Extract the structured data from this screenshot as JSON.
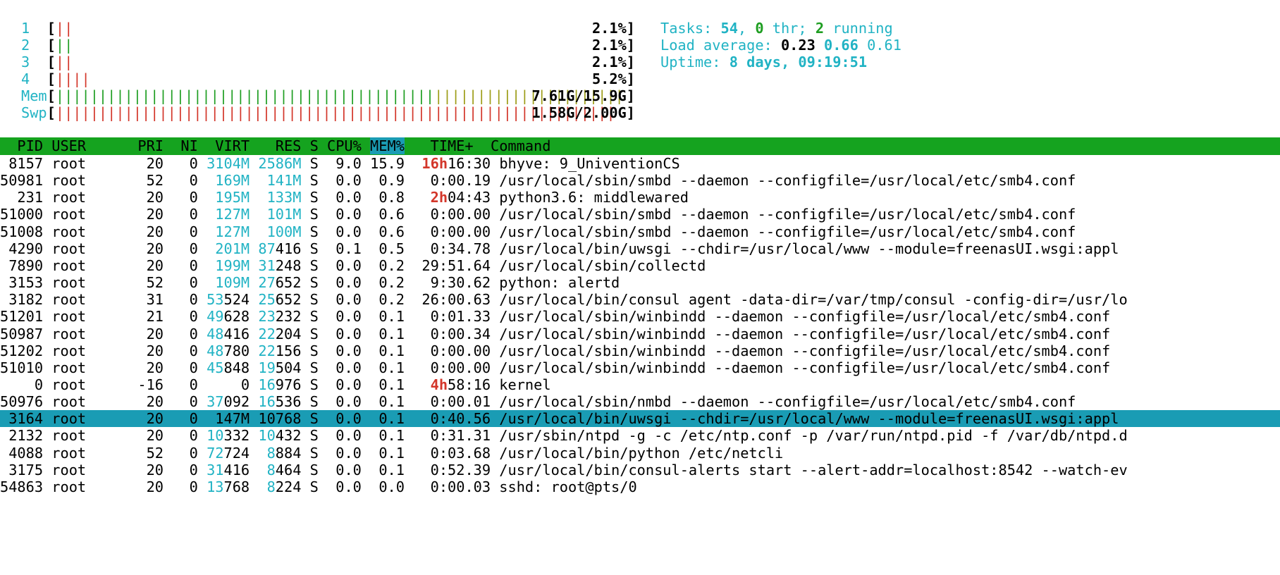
{
  "cpus": [
    {
      "label": "1",
      "bar_red": "||",
      "bar_green": "",
      "percent": "2.1%"
    },
    {
      "label": "2",
      "bar_red": "",
      "bar_green": "||",
      "percent": "2.1%"
    },
    {
      "label": "3",
      "bar_red": "||",
      "bar_green": "",
      "percent": "2.1%"
    },
    {
      "label": "4",
      "bar_red": "||||",
      "bar_green": "",
      "percent": "5.2%"
    }
  ],
  "mem": {
    "label": "Mem",
    "bar_green": "||||||||||||||||||||||||||||||||||||||||||||",
    "bar_olive": "||||||||||||||||||||||",
    "value": "7.61G/15.9G"
  },
  "swp": {
    "label": "Swp",
    "bar_red": "|||||||||||||||||||||||||||||||||||||||||||||||||||||||||||||||||",
    "value": "1.58G/2.00G"
  },
  "tasks": {
    "label": "Tasks: ",
    "count": "54",
    "sep1": ", ",
    "thr": "0",
    "thr_label": " thr; ",
    "running": "2",
    "running_label": " running"
  },
  "load": {
    "label": "Load average: ",
    "v1": "0.23",
    "v2": "0.66",
    "v3": "0.61"
  },
  "uptime": {
    "label": "Uptime: ",
    "value": "8 days, 09:19:51"
  },
  "header": {
    "left": "  PID USER      PRI  NI  VIRT   RES S CPU% ",
    "sort": "MEM%",
    "right": "   TIME+  Command"
  },
  "selected_pid": "3164",
  "processes": [
    {
      "pid": "8157",
      "user": "root",
      "pri": "20",
      "ni": "0",
      "virt": "3104M",
      "res": "2586M",
      "s": "S",
      "cpu": "9.0",
      "mem": "15.9",
      "time_hi": "16h",
      "time_lo": "16:30",
      "cmd": "bhyve: 9_UniventionCS"
    },
    {
      "pid": "50981",
      "user": "root",
      "pri": "52",
      "ni": "0",
      "virt": "169M",
      "res": "141M",
      "s": "S",
      "cpu": "0.0",
      "mem": "0.9",
      "time_hi": "",
      "time_lo": "0:00.19",
      "cmd": "/usr/local/sbin/smbd --daemon --configfile=/usr/local/etc/smb4.conf"
    },
    {
      "pid": "231",
      "user": "root",
      "pri": "20",
      "ni": "0",
      "virt": "195M",
      "res": "133M",
      "s": "S",
      "cpu": "0.0",
      "mem": "0.8",
      "time_hi": "2h",
      "time_lo": "04:43",
      "cmd": "python3.6: middlewared"
    },
    {
      "pid": "51000",
      "user": "root",
      "pri": "20",
      "ni": "0",
      "virt": "127M",
      "res": "101M",
      "s": "S",
      "cpu": "0.0",
      "mem": "0.6",
      "time_hi": "",
      "time_lo": "0:00.00",
      "cmd": "/usr/local/sbin/smbd --daemon --configfile=/usr/local/etc/smb4.conf"
    },
    {
      "pid": "51008",
      "user": "root",
      "pri": "20",
      "ni": "0",
      "virt": "127M",
      "res": "100M",
      "s": "S",
      "cpu": "0.0",
      "mem": "0.6",
      "time_hi": "",
      "time_lo": "0:00.00",
      "cmd": "/usr/local/sbin/smbd --daemon --configfile=/usr/local/etc/smb4.conf"
    },
    {
      "pid": "4290",
      "user": "root",
      "pri": "20",
      "ni": "0",
      "virt": "201M",
      "res": "87416",
      "s": "S",
      "cpu": "0.1",
      "mem": "0.5",
      "time_hi": "",
      "time_lo": "0:34.78",
      "cmd": "/usr/local/bin/uwsgi --chdir=/usr/local/www --module=freenasUI.wsgi:appl"
    },
    {
      "pid": "7890",
      "user": "root",
      "pri": "20",
      "ni": "0",
      "virt": "199M",
      "res": "31248",
      "s": "S",
      "cpu": "0.0",
      "mem": "0.2",
      "time_hi": "",
      "time_lo": "29:51.64",
      "cmd": "/usr/local/sbin/collectd"
    },
    {
      "pid": "3153",
      "user": "root",
      "pri": "52",
      "ni": "0",
      "virt": "109M",
      "res": "27652",
      "s": "S",
      "cpu": "0.0",
      "mem": "0.2",
      "time_hi": "",
      "time_lo": "9:30.62",
      "cmd": "python: alertd"
    },
    {
      "pid": "3182",
      "user": "root",
      "pri": "31",
      "ni": "0",
      "virt": "53524",
      "res": "25652",
      "s": "S",
      "cpu": "0.0",
      "mem": "0.2",
      "time_hi": "",
      "time_lo": "26:00.63",
      "cmd": "/usr/local/bin/consul agent -data-dir=/var/tmp/consul -config-dir=/usr/lo"
    },
    {
      "pid": "51201",
      "user": "root",
      "pri": "21",
      "ni": "0",
      "virt": "49628",
      "res": "23232",
      "s": "S",
      "cpu": "0.0",
      "mem": "0.1",
      "time_hi": "",
      "time_lo": "0:01.33",
      "cmd": "/usr/local/sbin/winbindd --daemon --configfile=/usr/local/etc/smb4.conf"
    },
    {
      "pid": "50987",
      "user": "root",
      "pri": "20",
      "ni": "0",
      "virt": "48416",
      "res": "22204",
      "s": "S",
      "cpu": "0.0",
      "mem": "0.1",
      "time_hi": "",
      "time_lo": "0:00.34",
      "cmd": "/usr/local/sbin/winbindd --daemon --configfile=/usr/local/etc/smb4.conf"
    },
    {
      "pid": "51202",
      "user": "root",
      "pri": "20",
      "ni": "0",
      "virt": "48780",
      "res": "22156",
      "s": "S",
      "cpu": "0.0",
      "mem": "0.1",
      "time_hi": "",
      "time_lo": "0:00.00",
      "cmd": "/usr/local/sbin/winbindd --daemon --configfile=/usr/local/etc/smb4.conf"
    },
    {
      "pid": "51010",
      "user": "root",
      "pri": "20",
      "ni": "0",
      "virt": "45848",
      "res": "19504",
      "s": "S",
      "cpu": "0.0",
      "mem": "0.1",
      "time_hi": "",
      "time_lo": "0:00.00",
      "cmd": "/usr/local/sbin/winbindd --daemon --configfile=/usr/local/etc/smb4.conf"
    },
    {
      "pid": "0",
      "user": "root",
      "pri": "-16",
      "ni": "0",
      "virt": "0",
      "res": "16976",
      "s": "S",
      "cpu": "0.0",
      "mem": "0.1",
      "time_hi": "4h",
      "time_lo": "58:16",
      "cmd": "kernel"
    },
    {
      "pid": "50976",
      "user": "root",
      "pri": "20",
      "ni": "0",
      "virt": "37092",
      "res": "16536",
      "s": "S",
      "cpu": "0.0",
      "mem": "0.1",
      "time_hi": "",
      "time_lo": "0:00.01",
      "cmd": "/usr/local/sbin/nmbd --daemon --configfile=/usr/local/etc/smb4.conf"
    },
    {
      "pid": "3164",
      "user": "root",
      "pri": "20",
      "ni": "0",
      "virt": "147M",
      "res": "10768",
      "s": "S",
      "cpu": "0.0",
      "mem": "0.1",
      "time_hi": "",
      "time_lo": "0:40.56",
      "cmd": "/usr/local/bin/uwsgi --chdir=/usr/local/www --module=freenasUI.wsgi:appl"
    },
    {
      "pid": "2132",
      "user": "root",
      "pri": "20",
      "ni": "0",
      "virt": "10332",
      "res": "10432",
      "s": "S",
      "cpu": "0.0",
      "mem": "0.1",
      "time_hi": "",
      "time_lo": "0:31.31",
      "cmd": "/usr/sbin/ntpd -g -c /etc/ntp.conf -p /var/run/ntpd.pid -f /var/db/ntpd.d"
    },
    {
      "pid": "4088",
      "user": "root",
      "pri": "52",
      "ni": "0",
      "virt": "72724",
      "res": "8884",
      "s": "S",
      "cpu": "0.0",
      "mem": "0.1",
      "time_hi": "",
      "time_lo": "0:03.68",
      "cmd": "/usr/local/bin/python /etc/netcli"
    },
    {
      "pid": "3175",
      "user": "root",
      "pri": "20",
      "ni": "0",
      "virt": "31416",
      "res": "8464",
      "s": "S",
      "cpu": "0.0",
      "mem": "0.1",
      "time_hi": "",
      "time_lo": "0:52.39",
      "cmd": "/usr/local/bin/consul-alerts start --alert-addr=localhost:8542 --watch-ev"
    },
    {
      "pid": "54863",
      "user": "root",
      "pri": "20",
      "ni": "0",
      "virt": "13768",
      "res": "8224",
      "s": "S",
      "cpu": "0.0",
      "mem": "0.0",
      "time_hi": "",
      "time_lo": "0:00.03",
      "cmd": "sshd: root@pts/0"
    }
  ]
}
